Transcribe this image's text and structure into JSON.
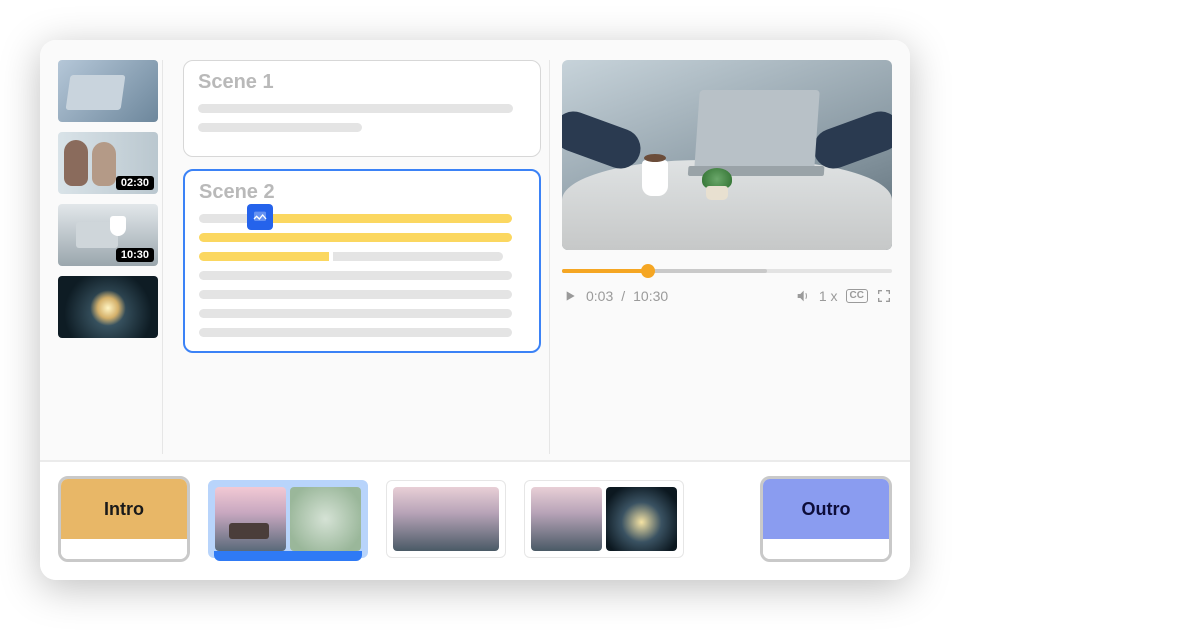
{
  "thumbnails": [
    {
      "time": ""
    },
    {
      "time": "02:30"
    },
    {
      "time": "10:30"
    },
    {
      "time": ""
    }
  ],
  "scenes": {
    "scene1": {
      "title": "Scene 1"
    },
    "scene2": {
      "title": "Scene 2"
    }
  },
  "player": {
    "current": "0:03",
    "separator": " / ",
    "duration": "10:30",
    "speed": "1 x",
    "progress_percent": 26,
    "buffer_percent": 62
  },
  "storyboard": {
    "intro_label": "Intro",
    "outro_label": "Outro"
  }
}
